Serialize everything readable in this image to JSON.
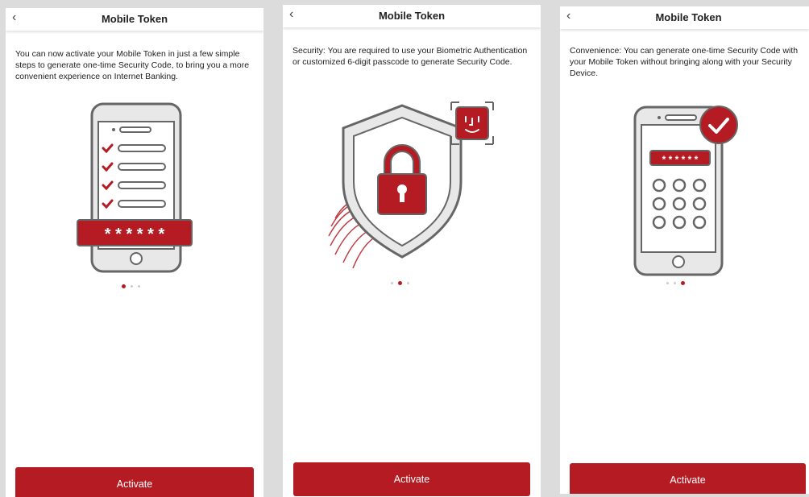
{
  "colors": {
    "accent": "#b41b22",
    "outline": "#666666",
    "phone_fill": "#e8e8e8"
  },
  "screens": [
    {
      "back_icon": "‹",
      "title": "Mobile Token",
      "description": "You can now activate your Mobile Token in just a few simple steps to generate one-time Security Code, to bring you a more convenient experience on Internet Banking.",
      "illustration": "phone-checklist-passcode",
      "passcode_mask": "* * * * * *",
      "page_index": 1,
      "page_count": 3,
      "button_label": "Activate"
    },
    {
      "back_icon": "‹",
      "title": "Mobile Token",
      "description": "Security: You are required to use your Biometric Authentication or customized 6-digit passcode to generate Security Code.",
      "illustration": "shield-lock-biometric",
      "page_index": 2,
      "page_count": 3,
      "button_label": "Activate"
    },
    {
      "back_icon": "‹",
      "title": "Mobile Token",
      "description": "Convenience: You can generate one-time Security Code with your Mobile Token without bringing along with your Security Device.",
      "illustration": "phone-keypad-check",
      "passcode_mask": "* * * * * *",
      "page_index": 3,
      "page_count": 3,
      "button_label": "Activate"
    }
  ]
}
